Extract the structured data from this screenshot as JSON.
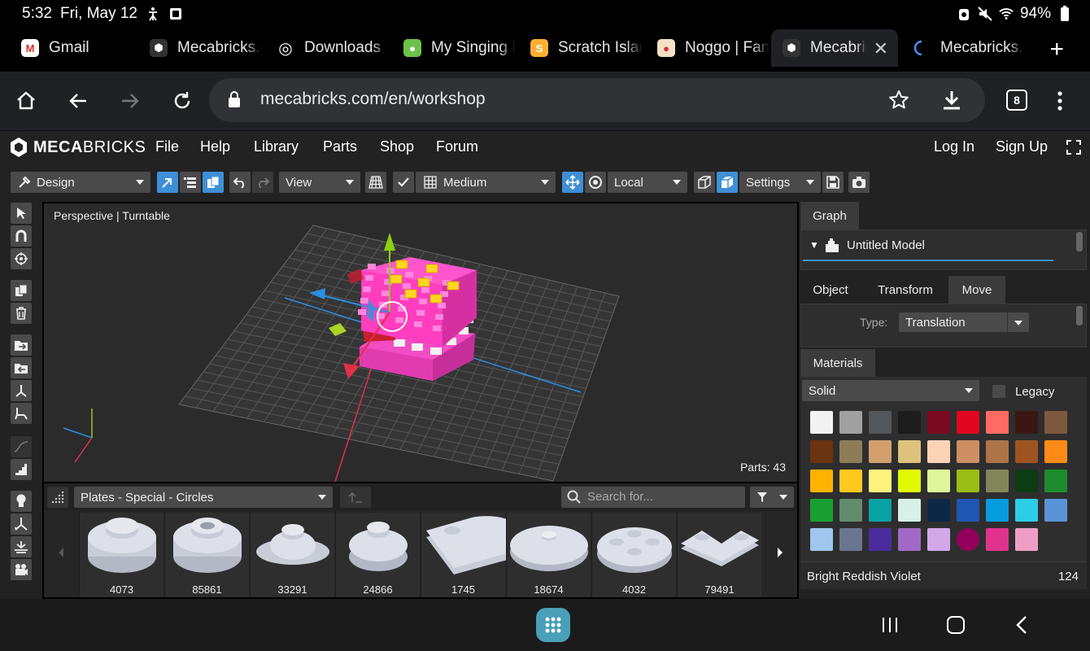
{
  "status": {
    "time": "5:32",
    "date": "Fri, May 12",
    "battery": "94%"
  },
  "tabs": [
    {
      "title": "Gmail",
      "icon": "gmail-icon"
    },
    {
      "title": "Mecabricks.c",
      "icon": "mecabricks-icon"
    },
    {
      "title": "Downloads",
      "icon": "chrome-icon"
    },
    {
      "title": "My Singing M",
      "icon": "game-icon"
    },
    {
      "title": "Scratch Islan",
      "icon": "scratch-icon"
    },
    {
      "title": "Noggo | Fanc",
      "icon": "fandom-icon"
    },
    {
      "title": "Mecabric",
      "icon": "mecabricks-icon",
      "active": true
    },
    {
      "title": "Mecabricks.c",
      "icon": "loading-icon"
    }
  ],
  "browser": {
    "url": "mecabricks.com/en/workshop",
    "tab_count": "8"
  },
  "app": {
    "logo_bold": "MECA",
    "logo_rest": "BRICKS",
    "menu": [
      "File",
      "Help",
      "Library",
      "Parts",
      "Shop",
      "Forum"
    ],
    "login": "Log In",
    "signup": "Sign Up"
  },
  "toolbar": {
    "mode": "Design",
    "view": "View",
    "grid": "Medium",
    "space": "Local",
    "settings": "Settings"
  },
  "viewport": {
    "label": "Perspective | Turntable",
    "parts_count": "Parts: 43"
  },
  "parts_browser": {
    "category": "Plates - Special - Circles",
    "search_placeholder": "Search for...",
    "items": [
      "4073",
      "85861",
      "33291",
      "24866",
      "1745",
      "18674",
      "4032",
      "79491"
    ]
  },
  "right_panel": {
    "graph_tab": "Graph",
    "model_name": "Untitled Model",
    "tabs": [
      "Object",
      "Transform",
      "Move"
    ],
    "type_label": "Type:",
    "type_value": "Translation",
    "materials_tab": "Materials",
    "material_type": "Solid",
    "legacy_label": "Legacy",
    "selected_color_name": "Bright Reddish Violet",
    "selected_color_id": "124",
    "swatches": [
      "#f2f2f2",
      "#a0a0a0",
      "#54575a",
      "#1c1c1c",
      "#7a0a1f",
      "#e0061f",
      "#ff6b63",
      "#3a1712",
      "#7d5a3e",
      "#6b3410",
      "#8c7d58",
      "#d2a06d",
      "#dcc27a",
      "#fcd3b4",
      "#cc8e62",
      "#ad7447",
      "#9e5420",
      "#fe8a18",
      "#feb200",
      "#ffc91f",
      "#fdf57b",
      "#e0fa00",
      "#dff79a",
      "#9bbd14",
      "#82875a",
      "#0d3b14",
      "#1e8c2e",
      "#17a02f",
      "#618c6d",
      "#06a3a2",
      "#d6f2e8",
      "#0c2848",
      "#2057b4",
      "#069ce0",
      "#2bcee8",
      "#5a93d5",
      "#9ec6ee",
      "#6a7690",
      "#4b2c9c",
      "#a06ac4",
      "#d2a8e8",
      "#92005c",
      "#e0338e",
      "#ee9ec4"
    ]
  },
  "colors": {
    "accent": "#3d8fd6",
    "brick_pink": "#ff3dbf",
    "brick_yellow": "#ffd61f"
  }
}
